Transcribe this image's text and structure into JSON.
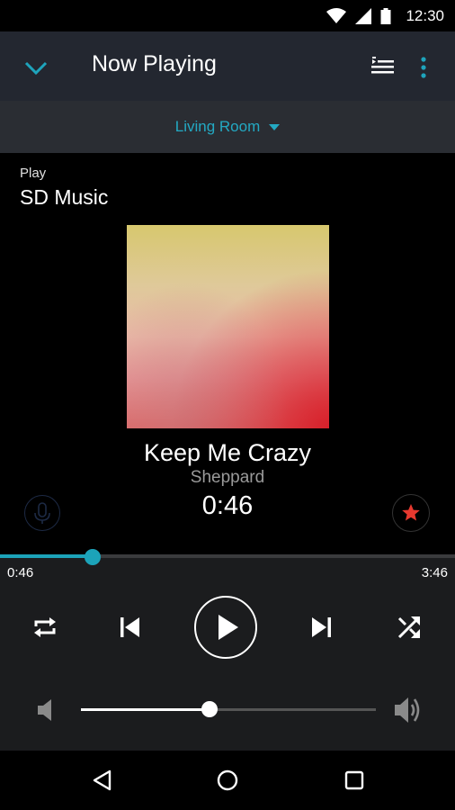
{
  "status_bar": {
    "time": "12:30",
    "icons": [
      "wifi-icon",
      "signal-icon",
      "battery-icon"
    ]
  },
  "app_bar": {
    "title": "Now Playing",
    "icons": [
      "chevron-down-icon",
      "queue-list-icon",
      "more-vert-icon"
    ]
  },
  "room_selector": {
    "label": "Living Room"
  },
  "source": {
    "caption": "Play",
    "name": "SD Music"
  },
  "track": {
    "title": "Keep Me Crazy",
    "artist": "Sheppard",
    "time_display": "0:46"
  },
  "progress": {
    "elapsed": "0:46",
    "duration": "3:46",
    "fraction": 0.2035
  },
  "volume": {
    "fraction": 0.435
  },
  "controls": [
    "repeat-icon",
    "skip-previous-icon",
    "play-icon",
    "skip-next-icon",
    "shuffle-icon"
  ],
  "colors": {
    "accent": "#1ca3b9",
    "room_label": "#23a9c3",
    "favorite": "#e8392f",
    "app_bar": "#232730"
  }
}
